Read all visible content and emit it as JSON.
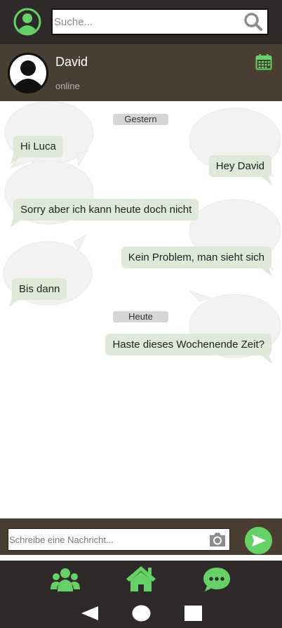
{
  "search": {
    "placeholder": "Suche..."
  },
  "contact": {
    "name": "David",
    "status": "online"
  },
  "separators": {
    "yesterday": "Gestern",
    "today": "Heute"
  },
  "messages": [
    {
      "text": "Hi Luca",
      "side": "in"
    },
    {
      "text": "Hey David",
      "side": "out"
    },
    {
      "text": "Sorry aber ich kann heute doch nicht",
      "side": "in"
    },
    {
      "text": "Kein Problem, man sieht sich",
      "side": "out"
    },
    {
      "text": "Bis dann",
      "side": "in"
    },
    {
      "text": "Haste dieses Wochenende Zeit?",
      "side": "out"
    }
  ],
  "composer": {
    "placeholder": "Schreibe eine Nachricht..."
  },
  "colors": {
    "accent": "#66d166",
    "bar_dark": "#2f2a2a",
    "bar_brown": "#4a3d31",
    "bubble": "#dfe9d8"
  },
  "icons": {
    "profile": "user-circle-icon",
    "search": "search-icon",
    "calendar": "calendar-icon",
    "camera": "camera-icon",
    "send": "send-icon",
    "nav": [
      "users-icon",
      "home-icon",
      "chat-icon"
    ],
    "system": [
      "back-icon",
      "home-circle-icon",
      "recents-square-icon"
    ]
  }
}
